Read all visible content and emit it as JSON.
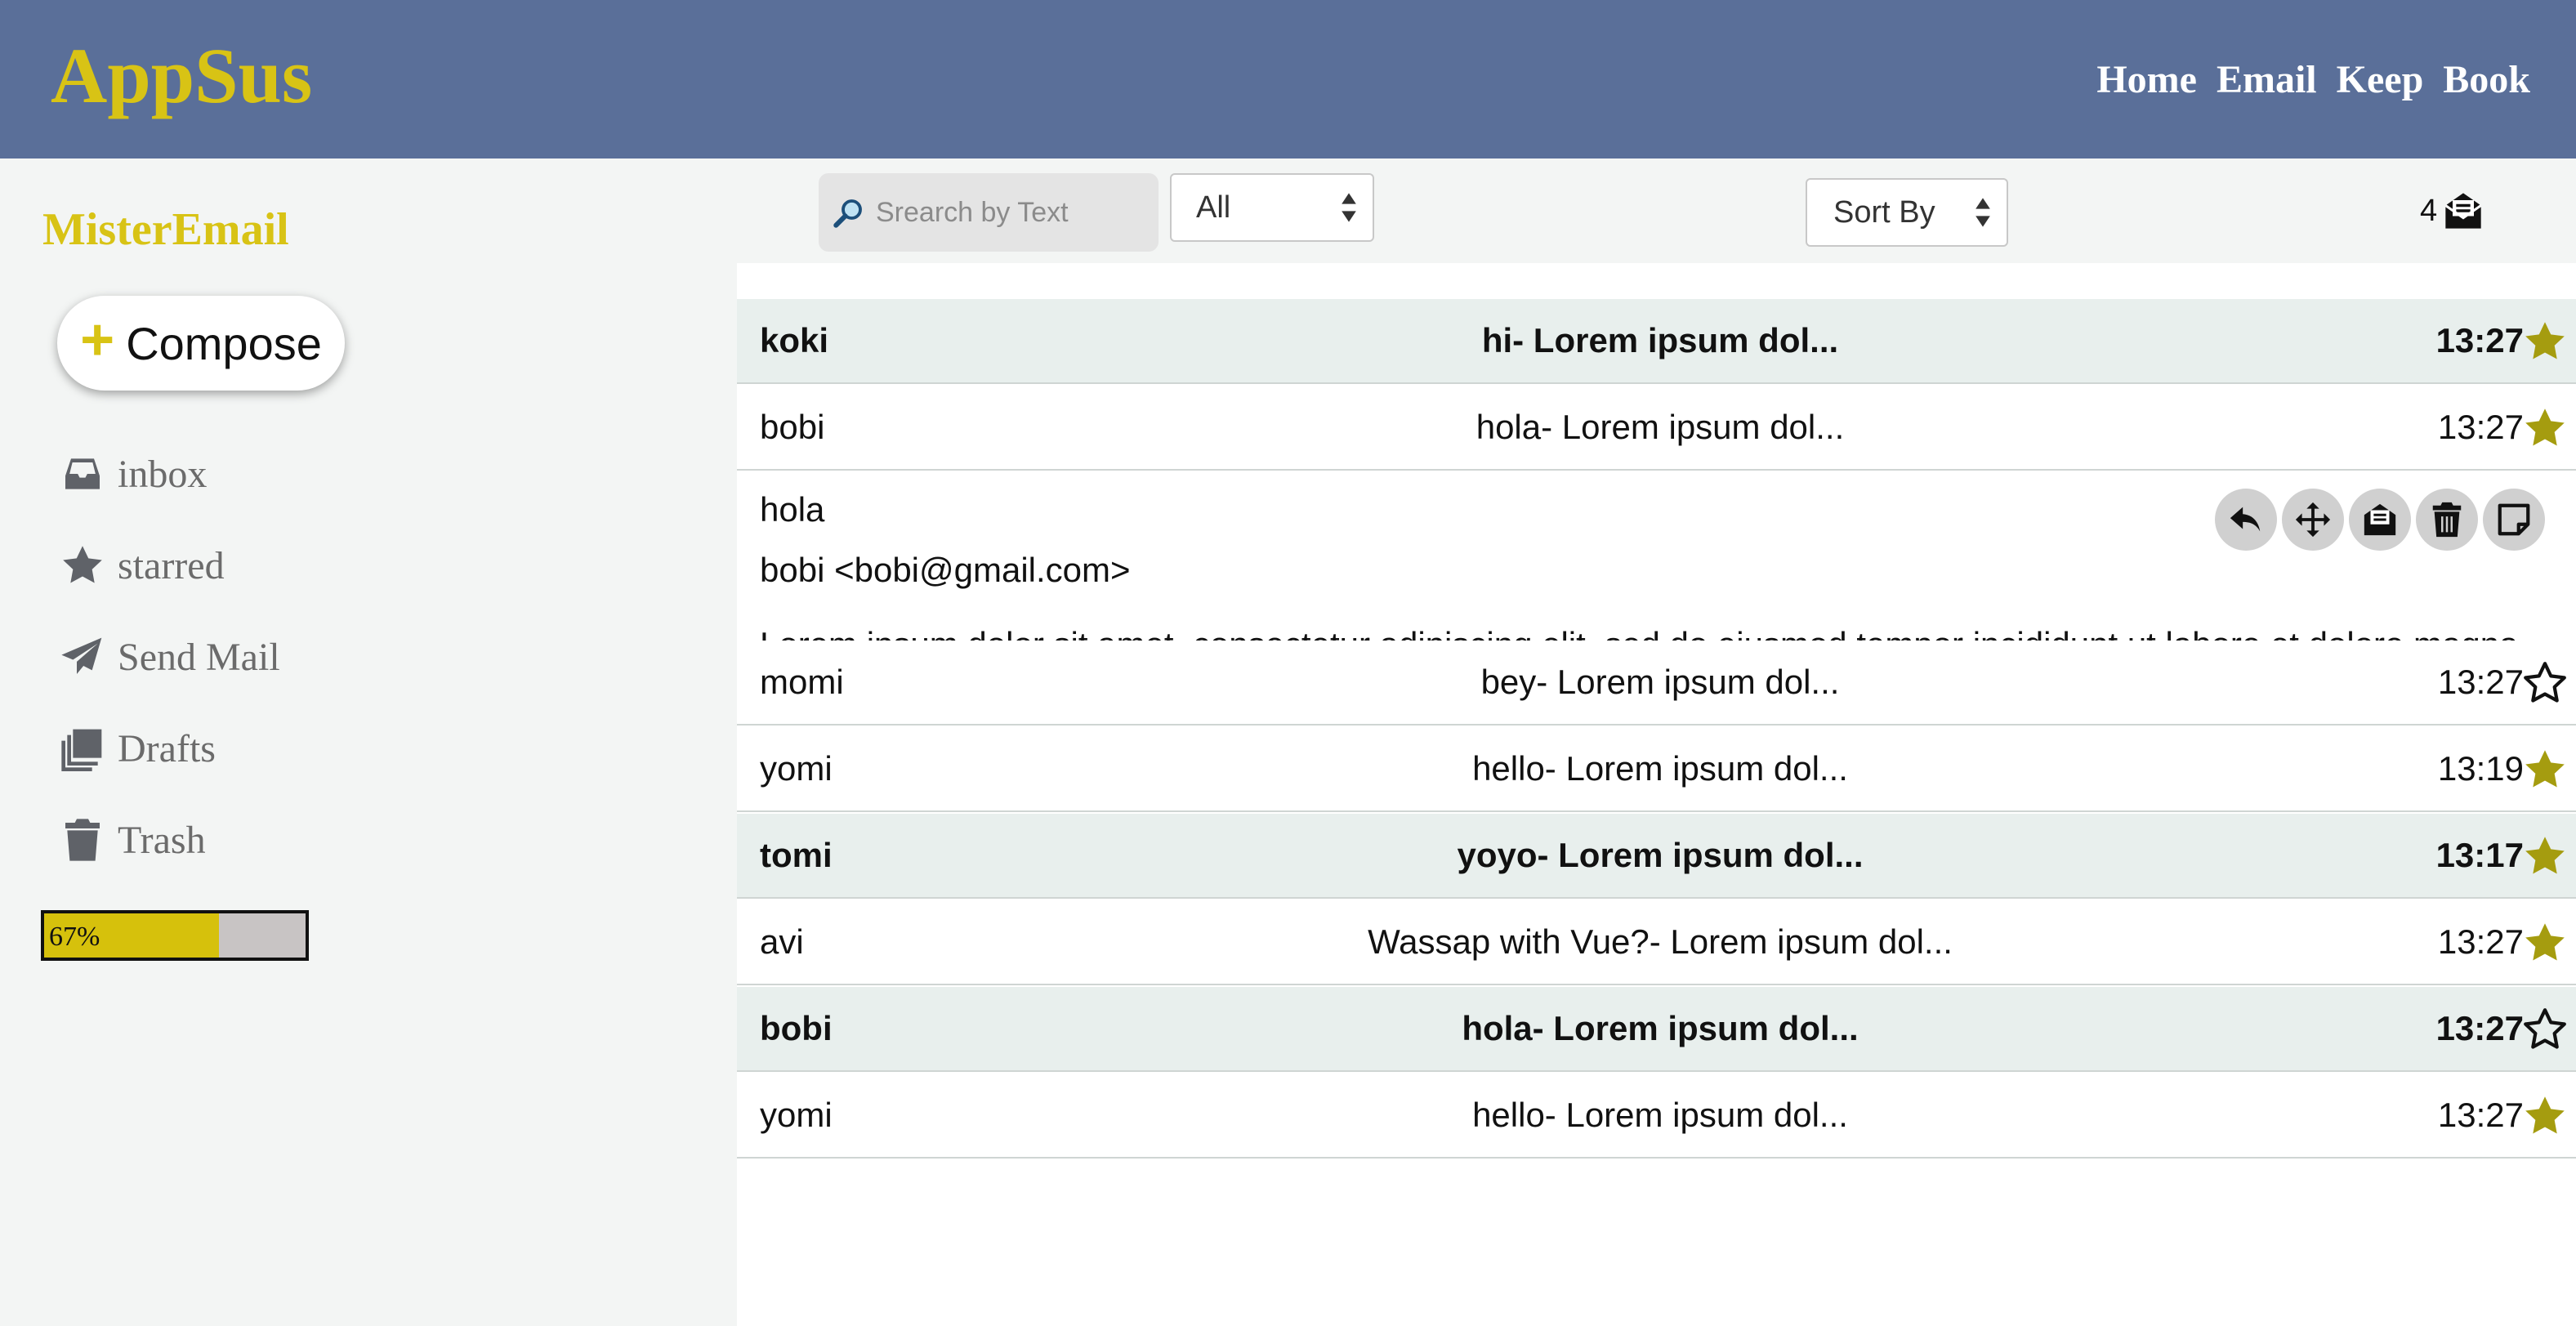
{
  "app": {
    "title": "AppSus"
  },
  "nav": {
    "items": [
      "Home",
      "Email",
      "Keep",
      "Book"
    ]
  },
  "sidebar": {
    "brand": "MisterEmail",
    "compose_label": "Compose",
    "folders": [
      {
        "label": "inbox",
        "icon": "inbox-icon"
      },
      {
        "label": "starred",
        "icon": "star-icon"
      },
      {
        "label": "Send Mail",
        "icon": "paper-plane-icon"
      },
      {
        "label": "Drafts",
        "icon": "drafts-icon"
      },
      {
        "label": "Trash",
        "icon": "trash-icon"
      }
    ],
    "progress": {
      "label": "67%",
      "value": 0.67
    }
  },
  "toolbar": {
    "search_placeholder": "Srearch by Text",
    "filter_value": "All",
    "sort_value": "Sort By",
    "unread_count": "4"
  },
  "emails": [
    {
      "from": "koki",
      "subject": "hi- Lorem ipsum dol...",
      "time": "13:27",
      "starred": true,
      "read": false
    },
    {
      "from": "bobi",
      "subject": "hola- Lorem ipsum dol...",
      "time": "13:27",
      "starred": true,
      "read": true
    },
    {
      "from": "momi",
      "subject": "bey- Lorem ipsum dol...",
      "time": "13:27",
      "starred": false,
      "read": true
    },
    {
      "from": "yomi",
      "subject": "hello- Lorem ipsum dol...",
      "time": "13:19",
      "starred": true,
      "read": true
    },
    {
      "from": "tomi",
      "subject": "yoyo- Lorem ipsum dol...",
      "time": "13:17",
      "starred": true,
      "read": false
    },
    {
      "from": "avi",
      "subject": "Wassap with Vue?- Lorem ipsum dol...",
      "time": "13:27",
      "starred": true,
      "read": true
    },
    {
      "from": "bobi",
      "subject": "hola- Lorem ipsum dol...",
      "time": "13:27",
      "starred": false,
      "read": false
    },
    {
      "from": "yomi",
      "subject": "hello- Lorem ipsum dol...",
      "time": "13:27",
      "starred": true,
      "read": true
    }
  ],
  "expanded": {
    "subject": "hola",
    "from": "bobi <bobi@gmail.com>",
    "body": "Lorem ipsum dolor sit amet, consectetur adipiscing elit, sed do eiusmod tempor incididunt ut labore et dolore magna aliqua. Ut enim ad minim veniam, quis nostrud exercitation ullamco laboris nisi ut aliquip ex ea commodo consequat.",
    "actions": [
      "reply-icon",
      "move-icon",
      "mark-read-icon",
      "trash-icon",
      "note-icon"
    ]
  },
  "colors": {
    "header": "#5a6f99",
    "accent": "#d8c315",
    "star_filled": "#a59c0f",
    "unread_row": "#e8efed"
  }
}
